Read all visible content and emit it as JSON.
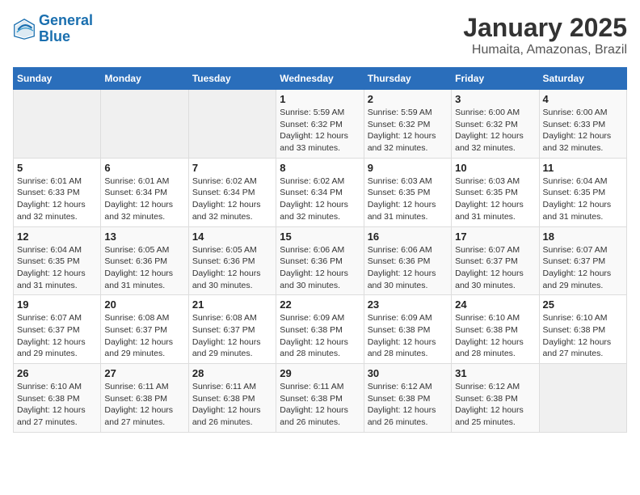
{
  "header": {
    "logo_line1": "General",
    "logo_line2": "Blue",
    "title": "January 2025",
    "subtitle": "Humaita, Amazonas, Brazil"
  },
  "weekdays": [
    "Sunday",
    "Monday",
    "Tuesday",
    "Wednesday",
    "Thursday",
    "Friday",
    "Saturday"
  ],
  "weeks": [
    [
      {
        "day": "",
        "info": ""
      },
      {
        "day": "",
        "info": ""
      },
      {
        "day": "",
        "info": ""
      },
      {
        "day": "1",
        "info": "Sunrise: 5:59 AM\nSunset: 6:32 PM\nDaylight: 12 hours\nand 33 minutes."
      },
      {
        "day": "2",
        "info": "Sunrise: 5:59 AM\nSunset: 6:32 PM\nDaylight: 12 hours\nand 32 minutes."
      },
      {
        "day": "3",
        "info": "Sunrise: 6:00 AM\nSunset: 6:32 PM\nDaylight: 12 hours\nand 32 minutes."
      },
      {
        "day": "4",
        "info": "Sunrise: 6:00 AM\nSunset: 6:33 PM\nDaylight: 12 hours\nand 32 minutes."
      }
    ],
    [
      {
        "day": "5",
        "info": "Sunrise: 6:01 AM\nSunset: 6:33 PM\nDaylight: 12 hours\nand 32 minutes."
      },
      {
        "day": "6",
        "info": "Sunrise: 6:01 AM\nSunset: 6:34 PM\nDaylight: 12 hours\nand 32 minutes."
      },
      {
        "day": "7",
        "info": "Sunrise: 6:02 AM\nSunset: 6:34 PM\nDaylight: 12 hours\nand 32 minutes."
      },
      {
        "day": "8",
        "info": "Sunrise: 6:02 AM\nSunset: 6:34 PM\nDaylight: 12 hours\nand 32 minutes."
      },
      {
        "day": "9",
        "info": "Sunrise: 6:03 AM\nSunset: 6:35 PM\nDaylight: 12 hours\nand 31 minutes."
      },
      {
        "day": "10",
        "info": "Sunrise: 6:03 AM\nSunset: 6:35 PM\nDaylight: 12 hours\nand 31 minutes."
      },
      {
        "day": "11",
        "info": "Sunrise: 6:04 AM\nSunset: 6:35 PM\nDaylight: 12 hours\nand 31 minutes."
      }
    ],
    [
      {
        "day": "12",
        "info": "Sunrise: 6:04 AM\nSunset: 6:35 PM\nDaylight: 12 hours\nand 31 minutes."
      },
      {
        "day": "13",
        "info": "Sunrise: 6:05 AM\nSunset: 6:36 PM\nDaylight: 12 hours\nand 31 minutes."
      },
      {
        "day": "14",
        "info": "Sunrise: 6:05 AM\nSunset: 6:36 PM\nDaylight: 12 hours\nand 30 minutes."
      },
      {
        "day": "15",
        "info": "Sunrise: 6:06 AM\nSunset: 6:36 PM\nDaylight: 12 hours\nand 30 minutes."
      },
      {
        "day": "16",
        "info": "Sunrise: 6:06 AM\nSunset: 6:36 PM\nDaylight: 12 hours\nand 30 minutes."
      },
      {
        "day": "17",
        "info": "Sunrise: 6:07 AM\nSunset: 6:37 PM\nDaylight: 12 hours\nand 30 minutes."
      },
      {
        "day": "18",
        "info": "Sunrise: 6:07 AM\nSunset: 6:37 PM\nDaylight: 12 hours\nand 29 minutes."
      }
    ],
    [
      {
        "day": "19",
        "info": "Sunrise: 6:07 AM\nSunset: 6:37 PM\nDaylight: 12 hours\nand 29 minutes."
      },
      {
        "day": "20",
        "info": "Sunrise: 6:08 AM\nSunset: 6:37 PM\nDaylight: 12 hours\nand 29 minutes."
      },
      {
        "day": "21",
        "info": "Sunrise: 6:08 AM\nSunset: 6:37 PM\nDaylight: 12 hours\nand 29 minutes."
      },
      {
        "day": "22",
        "info": "Sunrise: 6:09 AM\nSunset: 6:38 PM\nDaylight: 12 hours\nand 28 minutes."
      },
      {
        "day": "23",
        "info": "Sunrise: 6:09 AM\nSunset: 6:38 PM\nDaylight: 12 hours\nand 28 minutes."
      },
      {
        "day": "24",
        "info": "Sunrise: 6:10 AM\nSunset: 6:38 PM\nDaylight: 12 hours\nand 28 minutes."
      },
      {
        "day": "25",
        "info": "Sunrise: 6:10 AM\nSunset: 6:38 PM\nDaylight: 12 hours\nand 27 minutes."
      }
    ],
    [
      {
        "day": "26",
        "info": "Sunrise: 6:10 AM\nSunset: 6:38 PM\nDaylight: 12 hours\nand 27 minutes."
      },
      {
        "day": "27",
        "info": "Sunrise: 6:11 AM\nSunset: 6:38 PM\nDaylight: 12 hours\nand 27 minutes."
      },
      {
        "day": "28",
        "info": "Sunrise: 6:11 AM\nSunset: 6:38 PM\nDaylight: 12 hours\nand 26 minutes."
      },
      {
        "day": "29",
        "info": "Sunrise: 6:11 AM\nSunset: 6:38 PM\nDaylight: 12 hours\nand 26 minutes."
      },
      {
        "day": "30",
        "info": "Sunrise: 6:12 AM\nSunset: 6:38 PM\nDaylight: 12 hours\nand 26 minutes."
      },
      {
        "day": "31",
        "info": "Sunrise: 6:12 AM\nSunset: 6:38 PM\nDaylight: 12 hours\nand 25 minutes."
      },
      {
        "day": "",
        "info": ""
      }
    ]
  ]
}
